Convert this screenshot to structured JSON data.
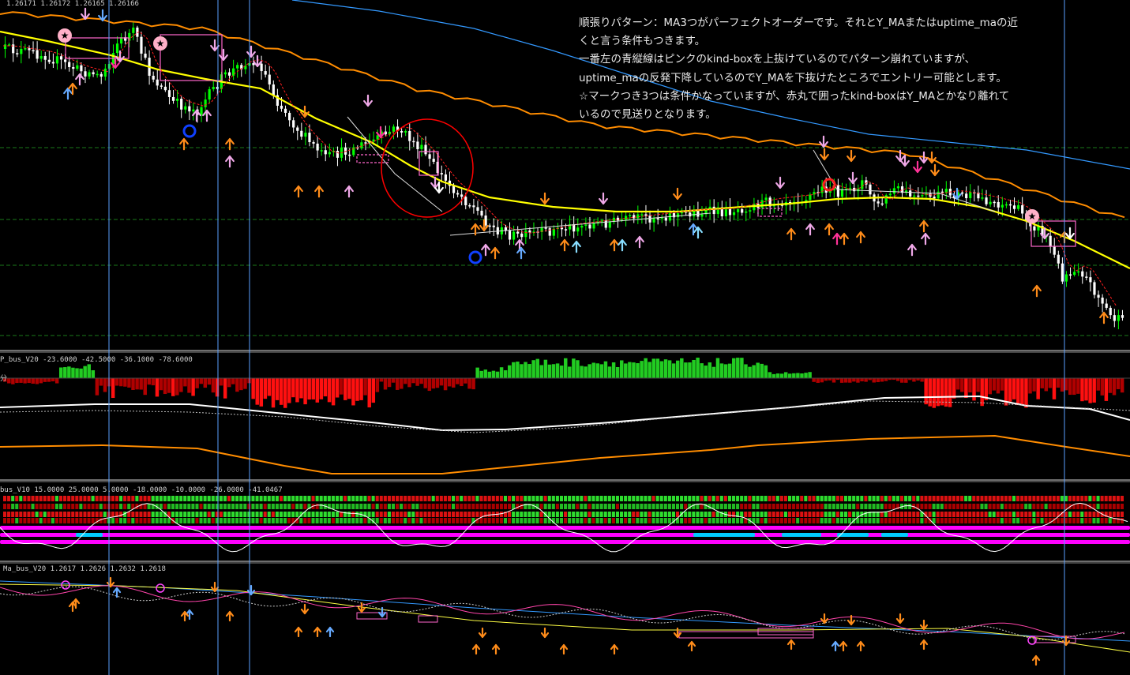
{
  "panes": {
    "main_header": "1.26171 1.26172 1.26165 1.26166",
    "p_bus_header": "P_bus_V20 -23.6000 -42.5000 -36.1000 -78.6000",
    "p_bus_sublabel": "分",
    "bus_header": "bus_V10 15.0000 25.0000 5.0000 -18.0000 -10.0000 -26.0000 -41.0467",
    "ma_bus_header": "Ma_bus_V20 1.2617 1.2626 1.2632 1.2618"
  },
  "annotation": {
    "lines": [
      "順張りパターン：MA3つがパーフェクトオーダーです。それとY_MAまたはuptime_maの近",
      "くと言う条件もつきます。",
      "一番左の青縦線はピンクのkind-boxを上抜けているのでパターン崩れていますが、",
      "uptime_maの反発下降しているのでY_MAを下抜けたところでエントリー可能とします。",
      "☆マークつき3つは条件かなっていますが、赤丸で囲ったkind-boxはY_MAとかなり離れて",
      "いるので見送りとなります。"
    ]
  },
  "colors": {
    "background": "#000000",
    "bull_candle": "#00ff00",
    "bear_candle": "#ffffff",
    "y_ma": "#ffff00",
    "band": "#ff8c00",
    "long_ma": "#3399ff",
    "fast_ma": "#ff2020",
    "kind_box": "#ff66cc",
    "circle": "#ff0000",
    "grid_green": "#1a7a1a",
    "vline": "#5aa0ff",
    "hist_up": "#22cc22",
    "hist_down": "#ee0000",
    "magenta_band": "#ff00ff",
    "cyan_seg": "#00ccff",
    "osc_line": "#ffffff"
  },
  "chart_data": [
    {
      "type": "candlestick",
      "pane": "main",
      "note": "approximate price path read visually (no price axis shown)",
      "series": [
        {
          "name": "",
          "kind": "close",
          "keyframes_x_bar": [
            0,
            8,
            16,
            22,
            28,
            34,
            40,
            48,
            56,
            62,
            70,
            78,
            86,
            92,
            100,
            108,
            116,
            124,
            132,
            140,
            148,
            156,
            164,
            172,
            180,
            188,
            196,
            204,
            212,
            220,
            228,
            236,
            244,
            252,
            260,
            268,
            276
          ],
          "keyframes_close_index": [
            84,
            80,
            90,
            70,
            66,
            62,
            76,
            90,
            92,
            96,
            92,
            90,
            96,
            120,
            110,
            118,
            114,
            150,
            145,
            140,
            136,
            135,
            140,
            128,
            138,
            150,
            128,
            130,
            135,
            118,
            98,
            108,
            170,
            156,
            168,
            174,
            182
          ]
        }
      ],
      "vertical_markers_bar": [
        27,
        53,
        62,
        262
      ],
      "markers": {
        "orange_up_arrows": 24,
        "orange_down_arrows": 14,
        "pink_up_arrows": 10,
        "pink_down_arrows": 12,
        "blue_up_arrows": 9,
        "star_markers": 3,
        "kind_boxes": 6,
        "red_circle": 1
      }
    },
    {
      "type": "bar",
      "pane": "P_bus_V20",
      "note": "histogram values are approximate (positive = green, negative = red)",
      "values_profile": "mixed",
      "series": [
        {
          "name": "",
          "kind": "histogram"
        },
        {
          "name": "",
          "kind": "white_line"
        },
        {
          "name": "",
          "kind": "orange_line"
        }
      ]
    },
    {
      "type": "heatmap",
      "pane": "bus_V10",
      "rows": 4,
      "note": "red/green cell matrix with magenta bands and white oscillator line"
    },
    {
      "type": "line",
      "pane": "Ma_bus_V20",
      "series": [
        {
          "name": "",
          "kind": "blue_ma"
        },
        {
          "name": "",
          "kind": "yellow_ma"
        },
        {
          "name": "",
          "kind": "pink_ma"
        },
        {
          "name": "",
          "kind": "dotted_ma"
        }
      ]
    }
  ]
}
